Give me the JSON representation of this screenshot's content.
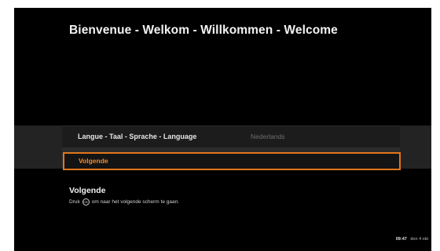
{
  "header": {
    "title": "Bienvenue - Welkom - Willkommen - Welcome"
  },
  "menu": {
    "language_label": "Langue - Taal - Sprache - Language",
    "language_value": "Nederlands",
    "next_label": "Volgende"
  },
  "help": {
    "title": "Volgende",
    "text_before": "Druk",
    "ok_icon": "OK",
    "text_after": "om naar het volgende scherm te gaan."
  },
  "status": {
    "time": "09:47",
    "date": "don 4 okt"
  },
  "colors": {
    "background": "#000000",
    "accent": "#e0761d",
    "menu_band": "#2b2b2b"
  }
}
